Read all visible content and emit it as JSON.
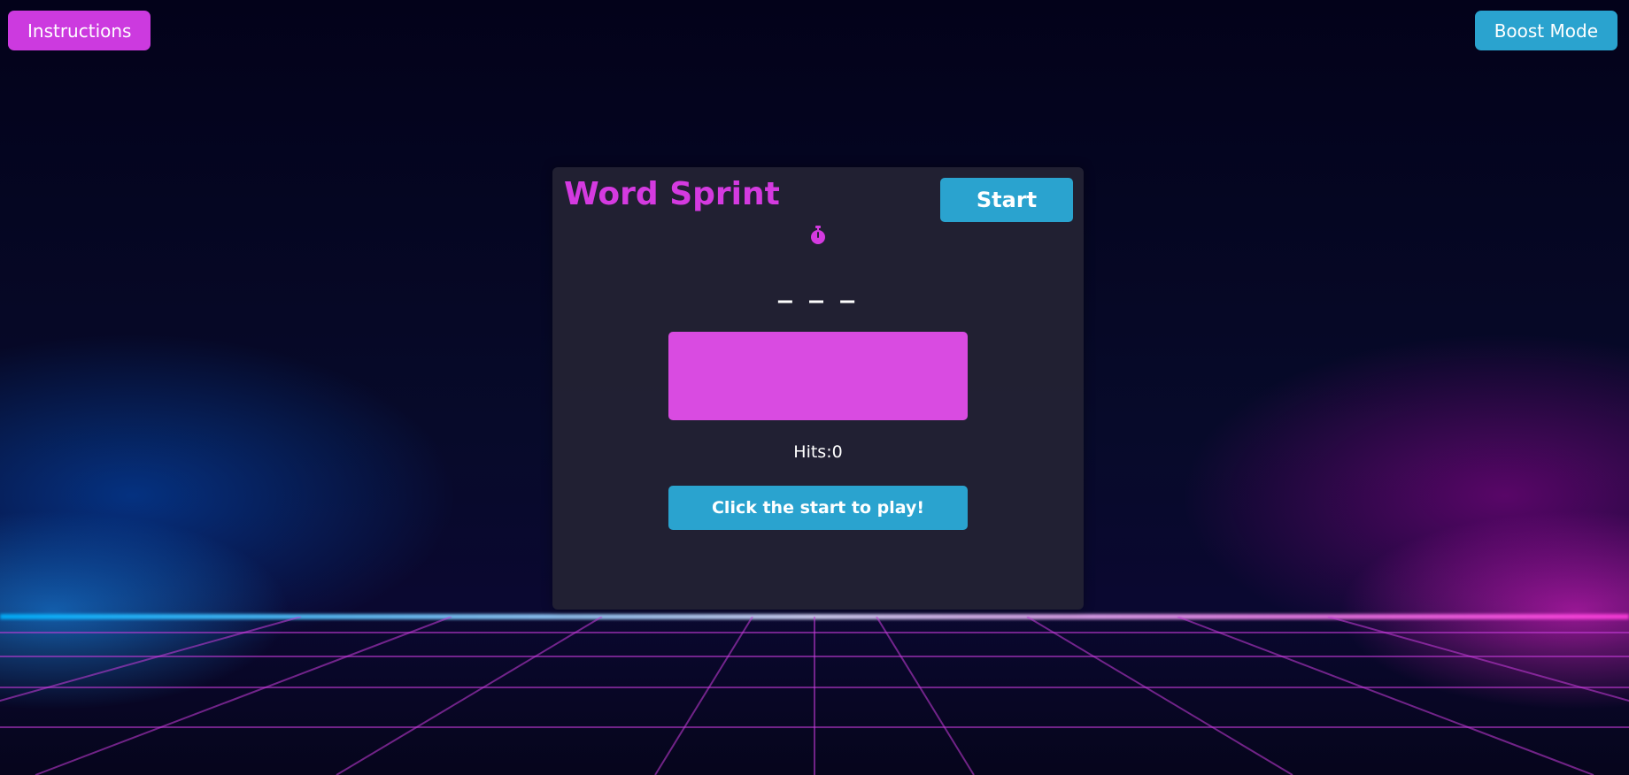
{
  "header": {
    "instructions_label": "Instructions",
    "boost_label": "Boost Mode"
  },
  "game": {
    "title": "Word Sprint",
    "start_label": "Start",
    "timer_icon": "stopwatch-icon",
    "word_display": "_ _ _",
    "input_value": "",
    "hits_label": "Hits:",
    "hits_value": "0",
    "play_label": "Click the start to play!"
  },
  "colors": {
    "accent_magenta": "#d43ae0",
    "accent_cyan": "#2aa3cf",
    "input_fill": "#d94be1",
    "card_bg": "#242234"
  }
}
